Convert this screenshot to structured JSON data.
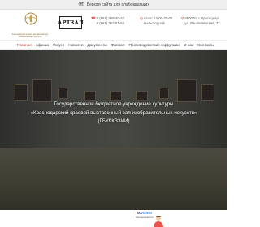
{
  "accessibility": {
    "label": "Версия сайта для слабовидящих",
    "icon": "eye-icon"
  },
  "emblem": {
    "caption": "Краснодарский краевой выставочный зал изобразительных искусств"
  },
  "logo": {
    "text": "АРТЗАЛ"
  },
  "contacts": {
    "phones": [
      "8 (861) 268-40-47",
      "8 (861) 262-81-62"
    ],
    "hours": [
      "вт-вс: 12:00-20:00",
      "пн-выходной"
    ],
    "address": [
      "350000, г. Краснодар,",
      "ул. Рашпилевская, 32"
    ]
  },
  "nav": {
    "items": [
      "Главная",
      "Афиша",
      "Услуги",
      "Новости",
      "Документы",
      "Филиал",
      "Противодействие коррупции",
      "О нас",
      "Контакты"
    ],
    "active_index": 0
  },
  "hero": {
    "lines": [
      "Государственное бюджетное учреждение культуры",
      "«Краснодарский краевой выставочный зал изобразительных искусств»",
      "(ГБУККВЗИИ)"
    ]
  },
  "promo": {
    "tag_prefix": "ГОС",
    "tag_suffix": "УСЛУГИ",
    "subtitle": "Решаем вместе"
  },
  "colors": {
    "accent": "#d62d20",
    "promo_blue": "#1e6fd9"
  }
}
